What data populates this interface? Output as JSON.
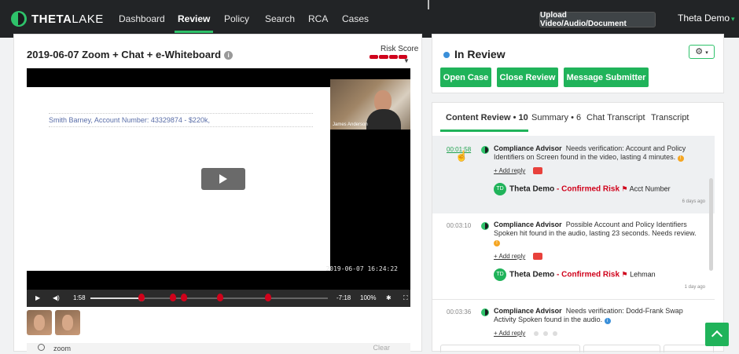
{
  "app": {
    "logo_bold": "THETA",
    "logo_light": "LAKE",
    "nav": [
      "Dashboard",
      "Review",
      "Policy",
      "Search",
      "RCA",
      "Cases"
    ],
    "active_nav": "Review",
    "upload_label": "Upload Video/Audio/Document",
    "user_name": "Theta Demo",
    "accent_color": "#2ec26a"
  },
  "video": {
    "title": "2019-06-07 Zoom + Chat + e-Whiteboard",
    "risk_label": "Risk Score",
    "whiteboard_text": "Smith Barney, Account Number: 43329874 - $220k,",
    "camera_name": "James Anderson",
    "timestamp": "2019-06-07 16:24:22",
    "current_time": "1:58",
    "remaining_time": "-7:18",
    "zoom_level": "100%",
    "progress": 0.215,
    "markers": [
      0.215,
      0.348,
      0.395,
      0.548,
      0.747
    ],
    "search_value": "zoom",
    "clear_label": "Clear"
  },
  "status": {
    "label": "In Review",
    "buttons": [
      "Open Case",
      "Close Review",
      "Message Submitter"
    ],
    "status_color": "#3a8fd9"
  },
  "review": {
    "tabs": [
      "Content Review • 10",
      "Summary • 6",
      "Chat Transcript",
      "Transcript"
    ],
    "comments": [
      {
        "time": "00:01:58",
        "author": "Compliance Advisor",
        "text": "Needs verification: Account and Policy Identifiers on Screen found in the video, lasting 4 minutes.",
        "add_reply": "+ Add reply",
        "reviewer_initials": "TD",
        "reviewer": "Theta Demo",
        "risk": "Confirmed Risk",
        "flag_text": "Acct Number",
        "ago": "6 days ago"
      },
      {
        "time": "00:03:10",
        "author": "Compliance Advisor",
        "text": "Possible Account and Policy Identifiers Spoken hit found in the audio, lasting 23 seconds. Needs review.",
        "add_reply": "+ Add reply",
        "reviewer_initials": "TD",
        "reviewer": "Theta Demo",
        "risk": "Confirmed Risk",
        "flag_text": "Lehman",
        "ago": "1 day ago"
      },
      {
        "time": "00:03:36",
        "author": "Compliance Advisor",
        "text": "Needs verification: Dodd-Frank Swap Activity Spoken found in the audio.",
        "add_reply": "+ Add reply"
      }
    ]
  }
}
